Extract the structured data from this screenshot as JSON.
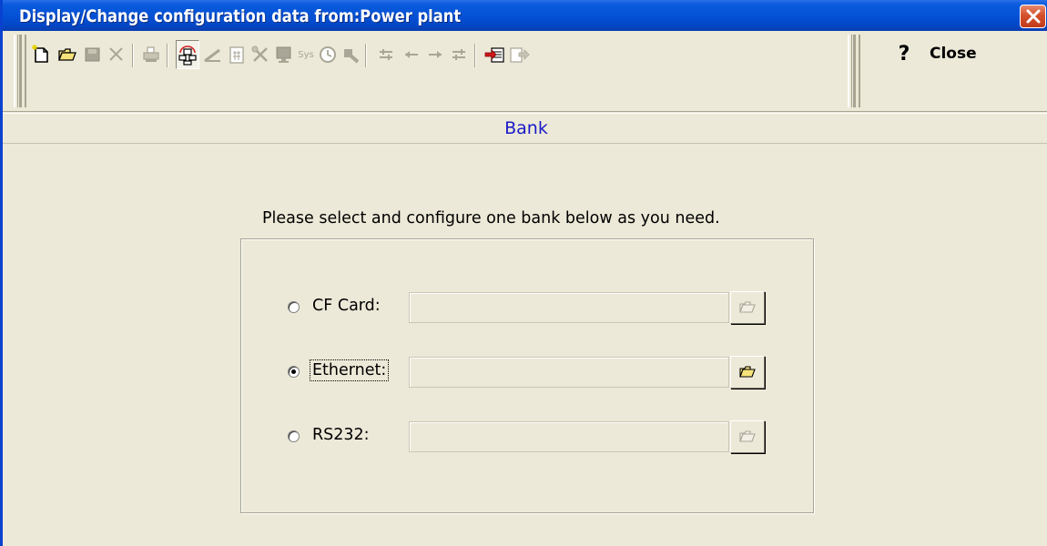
{
  "window": {
    "title": "Display/Change configuration data from:Power plant"
  },
  "toolbar": {
    "icons": [
      "new-document-icon",
      "open-folder-icon",
      "save-icon",
      "delete-icon",
      "print-icon",
      "network-icon",
      "line-icon",
      "calculator-icon",
      "tools-icon",
      "monitor-icon",
      "sys-icon",
      "clock-icon",
      "key-icon",
      "align-icon",
      "left-arrow-icon",
      "right-arrow-icon",
      "align-right-icon",
      "import-icon",
      "export-icon"
    ],
    "sys_label": "Sys",
    "help_label": "?",
    "close_label": "Close"
  },
  "section": {
    "title": "Bank"
  },
  "form": {
    "instruction": "Please select and configure one bank below as you need.",
    "options": [
      {
        "label": "CF Card:",
        "selected": false,
        "value": "",
        "enabled": false
      },
      {
        "label": "Ethernet:",
        "selected": true,
        "value": "",
        "enabled": true
      },
      {
        "label": "RS232:",
        "selected": false,
        "value": "",
        "enabled": false
      }
    ]
  },
  "colors": {
    "titlebar": "#0553d8",
    "background": "#ece9d8",
    "bank_title": "#1a1ac8",
    "close_button": "#c23a1a"
  }
}
